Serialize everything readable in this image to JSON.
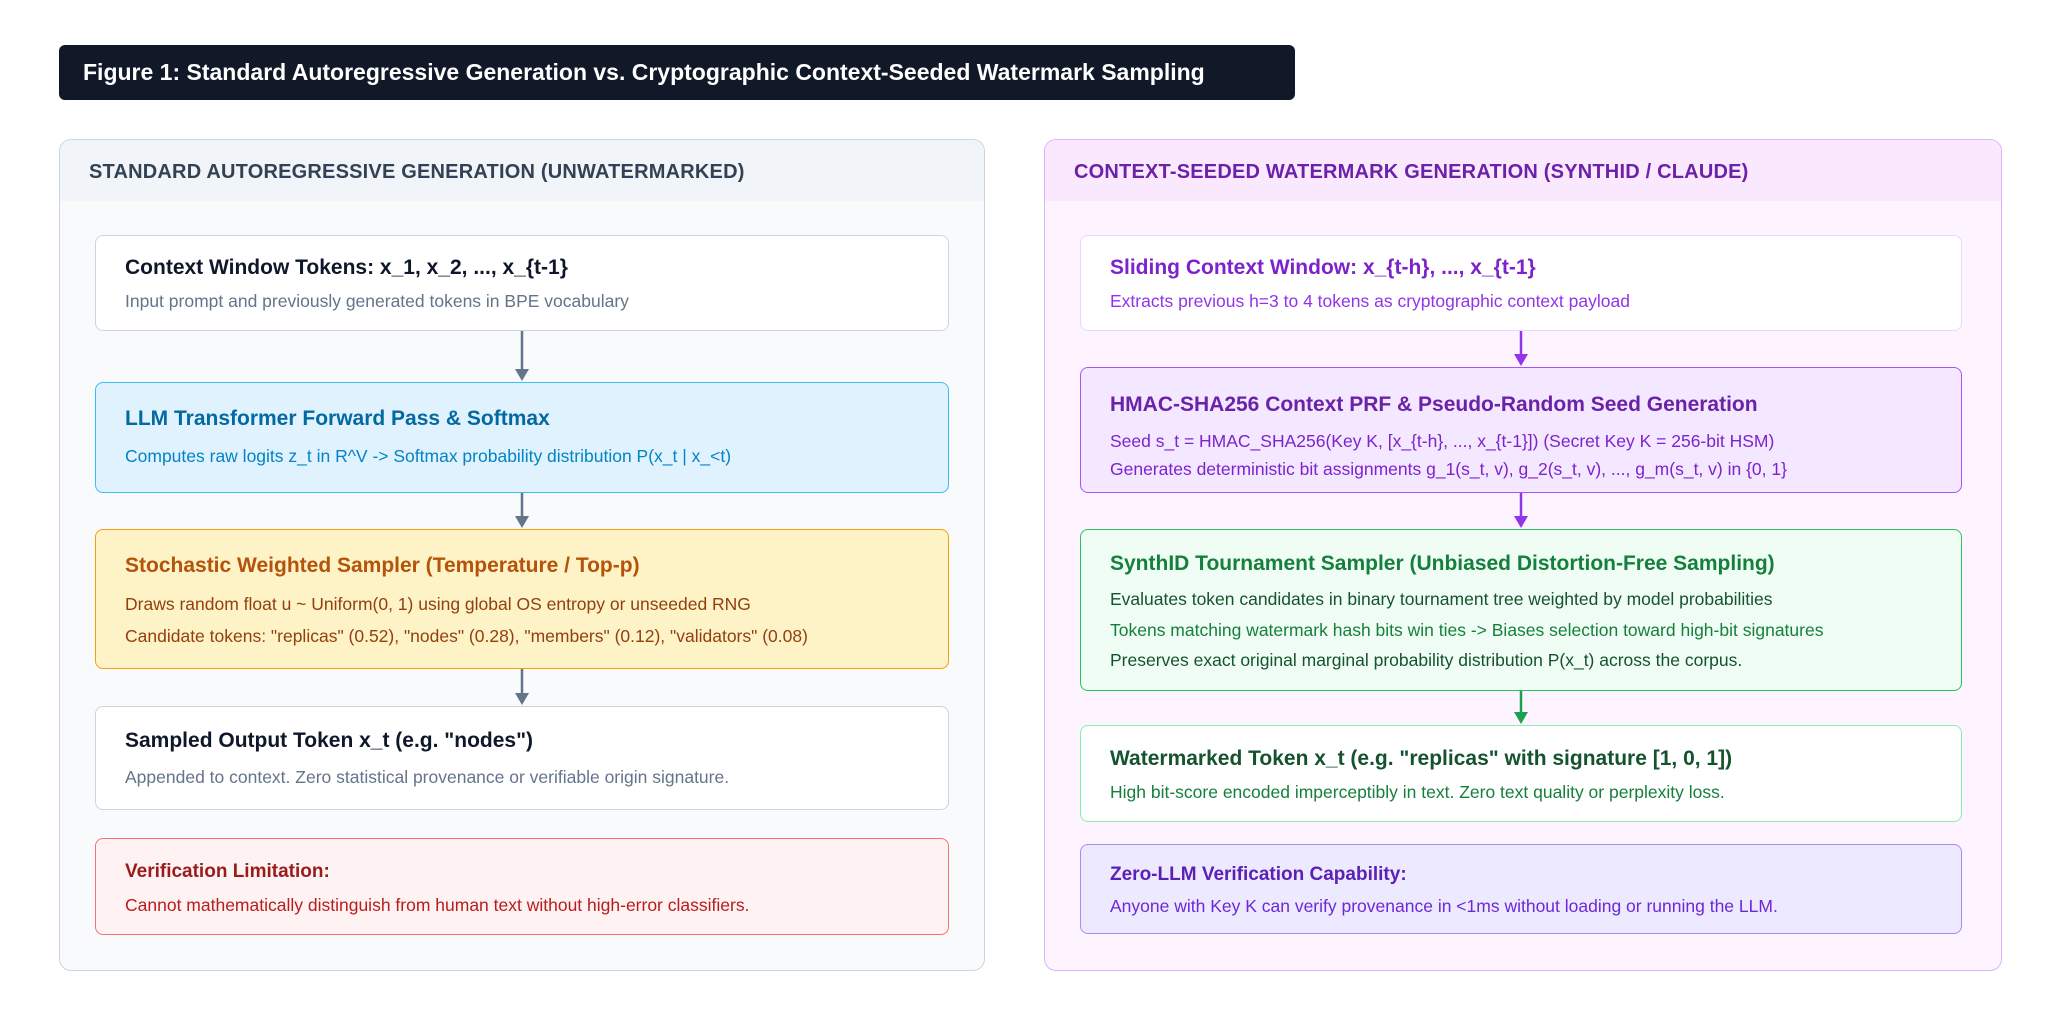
{
  "figure_title": "Figure 1: Standard Autoregressive Generation vs. Cryptographic Context-Seeded Watermark Sampling",
  "left_panel": {
    "header": "STANDARD AUTOREGRESSIVE GENERATION (UNWATERMARKED)",
    "boxes": [
      {
        "title": "Context Window Tokens: x_1, x_2, ..., x_{t-1}",
        "lines": [
          "Input prompt and previously generated tokens in BPE vocabulary"
        ]
      },
      {
        "title": "LLM Transformer Forward Pass & Softmax",
        "lines": [
          "Computes raw logits z_t in R^V -> Softmax probability distribution P(x_t | x_<t)"
        ]
      },
      {
        "title": "Stochastic Weighted Sampler (Temperature / Top-p)",
        "lines": [
          "Draws random float u ~ Uniform(0, 1) using global OS entropy or unseeded RNG",
          "Candidate tokens: \"replicas\" (0.52), \"nodes\" (0.28), \"members\" (0.12), \"validators\" (0.08)"
        ]
      },
      {
        "title": "Sampled Output Token x_t (e.g. \"nodes\")",
        "lines": [
          "Appended to context. Zero statistical provenance or verifiable origin signature."
        ]
      },
      {
        "title": "Verification Limitation:",
        "lines": [
          "Cannot mathematically distinguish from human text without high-error classifiers."
        ]
      }
    ]
  },
  "right_panel": {
    "header": "CONTEXT-SEEDED WATERMARK GENERATION (SYNTHID / CLAUDE)",
    "boxes": [
      {
        "title": "Sliding Context Window: x_{t-h}, ..., x_{t-1}",
        "lines": [
          "Extracts previous h=3 to 4 tokens as cryptographic context payload"
        ]
      },
      {
        "title": "HMAC-SHA256 Context PRF & Pseudo-Random Seed Generation",
        "lines": [
          "Seed s_t = HMAC_SHA256(Key K, [x_{t-h}, ..., x_{t-1}]) (Secret Key K = 256-bit HSM)",
          "Generates deterministic bit assignments g_1(s_t, v), g_2(s_t, v), ..., g_m(s_t, v) in {0, 1}"
        ]
      },
      {
        "title": "SynthID Tournament Sampler (Unbiased Distortion-Free Sampling)",
        "lines": [
          "Evaluates token candidates in binary tournament tree weighted by model probabilities",
          "Tokens matching watermark hash bits win ties -> Biases selection toward high-bit signatures",
          "Preserves exact original marginal probability distribution P(x_t) across the corpus."
        ]
      },
      {
        "title": "Watermarked Token x_t (e.g. \"replicas\" with signature [1, 0, 1])",
        "lines": [
          "High bit-score encoded imperceptibly in text. Zero text quality or perplexity loss."
        ]
      },
      {
        "title": "Zero-LLM Verification Capability:",
        "lines": [
          "Anyone with Key K can verify provenance in <1ms without loading or running the LLM."
        ]
      }
    ]
  },
  "colors": {
    "dark": "#111827",
    "slate": "#64748b",
    "blue": "#0369a1",
    "orange": "#b45309",
    "red": "#991b1b",
    "purple": "#6b21a8",
    "green": "#15803d"
  }
}
